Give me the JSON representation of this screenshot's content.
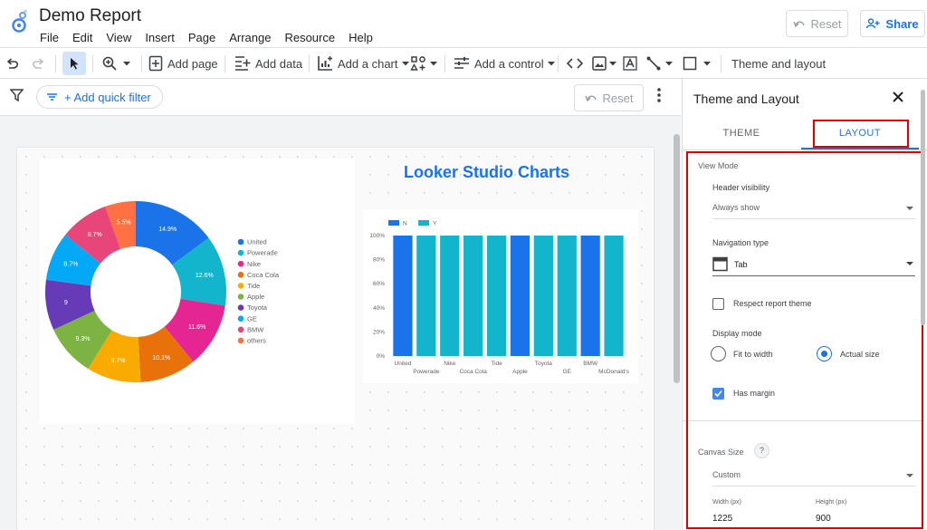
{
  "header": {
    "doc_title": "Demo Report",
    "menu": [
      "File",
      "Edit",
      "View",
      "Insert",
      "Page",
      "Arrange",
      "Resource",
      "Help"
    ],
    "reset_label": "Reset",
    "share_label": "Share"
  },
  "toolbar": {
    "add_page": "Add page",
    "add_data": "Add data",
    "add_chart": "Add a chart",
    "add_control": "Add a control",
    "theme_layout": "Theme and layout"
  },
  "filterbar": {
    "quick_filter": "+ Add quick filter",
    "reset_label": "Reset"
  },
  "report": {
    "title": "Looker Studio Charts"
  },
  "chart_data": [
    {
      "type": "pie",
      "categories": [
        "United",
        "Powerade",
        "Nike",
        "Coca Cola",
        "Tide",
        "Apple",
        "Toyota",
        "GE",
        "BMW",
        "others"
      ],
      "values": [
        14.9,
        12.6,
        11.6,
        10.1,
        9.7,
        9.3,
        9,
        8.7,
        8.7,
        5.5
      ],
      "value_labels": [
        "14.9%",
        "12.6%",
        "11.6%",
        "10.1%",
        "9.7%",
        "9.3%",
        "9",
        "8.7%",
        "8.7%",
        "5.5%"
      ],
      "colors": [
        "#1a73e8",
        "#12b5cb",
        "#e52592",
        "#e8710a",
        "#f9ab00",
        "#7cb342",
        "#673ab7",
        "#03a9f4",
        "#e8457a",
        "#ff7043"
      ],
      "donut": true,
      "legend_position": "right"
    },
    {
      "type": "bar",
      "stacked": "100%",
      "categories": [
        "United",
        "Powerade",
        "Nike",
        "Coca Cola",
        "Tide",
        "Apple",
        "Toyota",
        "GE",
        "BMW",
        "McDonald's"
      ],
      "series": [
        {
          "name": "N",
          "values": [
            100,
            0,
            0,
            0,
            0,
            100,
            0,
            0,
            100,
            0
          ],
          "color": "#1a73e8"
        },
        {
          "name": "Y",
          "values": [
            0,
            100,
            100,
            100,
            100,
            0,
            100,
            100,
            0,
            100
          ],
          "color": "#12b5cb"
        }
      ],
      "yticks": [
        "0%",
        "20%",
        "40%",
        "60%",
        "80%",
        "100%"
      ],
      "ylim": [
        0,
        100
      ],
      "legend_position": "top-left"
    }
  ],
  "panel": {
    "title": "Theme and Layout",
    "tab_theme": "THEME",
    "tab_layout": "LAYOUT",
    "view_mode": "View Mode",
    "header_visibility_label": "Header visibility",
    "header_visibility_value": "Always show",
    "navigation_type_label": "Navigation type",
    "navigation_type_value": "Tab",
    "respect_theme": "Respect report theme",
    "respect_theme_checked": false,
    "display_mode": "Display mode",
    "fit_to_width": "Fit to width",
    "actual_size": "Actual size",
    "display_mode_selected": "Actual size",
    "has_margin": "Has margin",
    "has_margin_checked": true,
    "canvas_size": "Canvas Size",
    "help": "?",
    "canvas_size_value": "Custom",
    "width_label": "Width (px)",
    "height_label": "Height (px)",
    "width_value": "1225",
    "height_value": "900"
  },
  "colors": {
    "accent": "#1a73e8",
    "highlight": "#e00000"
  }
}
